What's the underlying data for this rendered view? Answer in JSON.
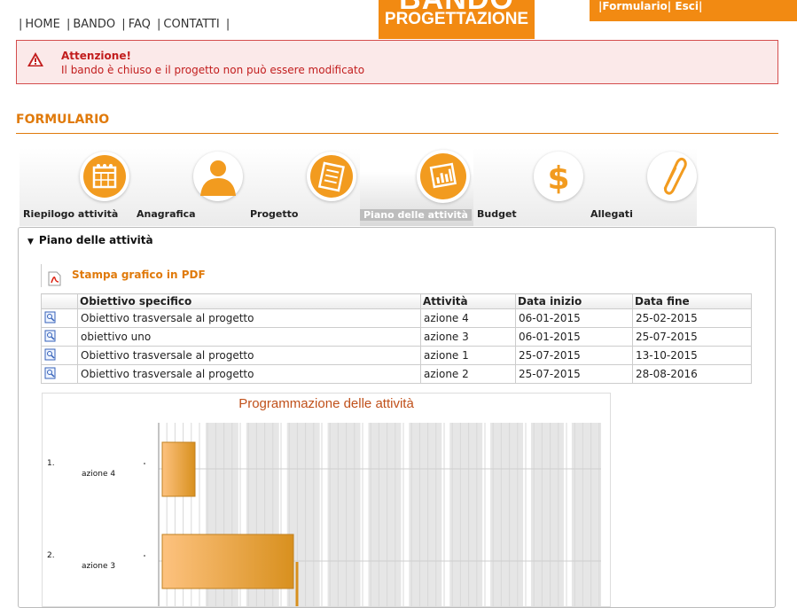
{
  "nav": {
    "home": "HOME",
    "bando": "BANDO",
    "faq": "FAQ",
    "contatti": "CONTATTI",
    "sep": "|"
  },
  "logo": {
    "big": "BANDO",
    "small": "PROGETTAZIONE"
  },
  "userbar": {
    "formulario": "Formulario",
    "esci": "Esci",
    "sep": "|"
  },
  "alert": {
    "title": "Attenzione!",
    "message": "Il bando è chiuso e il progetto non può essere modificato"
  },
  "section": {
    "title": "FORMULARIO"
  },
  "tabs": [
    {
      "label": "Riepilogo attività",
      "icon": "calendar-icon"
    },
    {
      "label": "Anagrafica",
      "icon": "person-icon"
    },
    {
      "label": "Progetto",
      "icon": "checklist-icon"
    },
    {
      "label": "Piano delle attività",
      "icon": "chart-icon",
      "active": true
    },
    {
      "label": "Budget",
      "icon": "dollar-icon"
    },
    {
      "label": "Allegati",
      "icon": "paperclip-icon"
    }
  ],
  "panel": {
    "title": "Piano delle attività",
    "pdf_link": "Stampa grafico in PDF"
  },
  "table": {
    "headers": [
      "Obiettivo specifico",
      "Attività",
      "Data inizio",
      "Data fine"
    ],
    "rows": [
      {
        "obiettivo": "Obiettivo trasversale al progetto",
        "attivita": "azione 4",
        "inizio": "06-01-2015",
        "fine": "25-02-2015"
      },
      {
        "obiettivo": "obiettivo uno",
        "attivita": "azione 3",
        "inizio": "06-01-2015",
        "fine": "25-07-2015"
      },
      {
        "obiettivo": "Obiettivo trasversale al progetto",
        "attivita": "azione 1",
        "inizio": "25-07-2015",
        "fine": "13-10-2015"
      },
      {
        "obiettivo": "Obiettivo trasversale al progetto",
        "attivita": "azione 2",
        "inizio": "25-07-2015",
        "fine": "28-08-2016"
      }
    ]
  },
  "chart_data": {
    "type": "bar",
    "title": "Programmazione delle attività",
    "categories": [
      "azione 4",
      "azione 3"
    ],
    "row_numbers": [
      "1.",
      "2."
    ],
    "start": [
      "06-01-2015",
      "06-01-2015"
    ],
    "end": [
      "25-02-2015",
      "25-07-2015"
    ],
    "xlabel": "",
    "ylabel": "",
    "grid": true,
    "colors": {
      "bar_light": "#fdc27f",
      "bar_dark": "#d8901e",
      "title": "#c0501a"
    }
  },
  "colors": {
    "accent": "#f28a12",
    "alert_border": "#d44d4d",
    "alert_bg": "#fbe9e9",
    "alert_text": "#c21d1d"
  }
}
